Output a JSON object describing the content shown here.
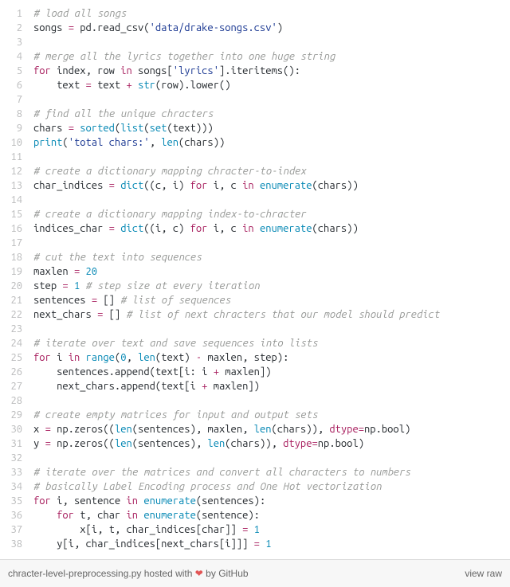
{
  "lines": [
    {
      "n": "1",
      "html": "<span class='c'># load all songs</span>"
    },
    {
      "n": "2",
      "html": "songs <span class='op'>=</span> pd.read_csv(<span class='s'>'data/drake-songs.csv'</span>)"
    },
    {
      "n": "3",
      "html": ""
    },
    {
      "n": "4",
      "html": "<span class='c'># merge all the lyrics together into one huge string</span>"
    },
    {
      "n": "5",
      "html": "<span class='k'>for</span> index, row <span class='k'>in</span> songs[<span class='s'>'lyrics'</span>].iteritems():"
    },
    {
      "n": "6",
      "html": "    text <span class='op'>=</span> text <span class='op'>+</span> <span class='fn'>str</span>(row).lower()"
    },
    {
      "n": "7",
      "html": ""
    },
    {
      "n": "8",
      "html": "<span class='c'># find all the unique chracters</span>"
    },
    {
      "n": "9",
      "html": "chars <span class='op'>=</span> <span class='fn'>sorted</span>(<span class='fn'>list</span>(<span class='fn'>set</span>(text)))"
    },
    {
      "n": "10",
      "html": "<span class='fn'>print</span>(<span class='s'>'total chars:'</span>, <span class='fn'>len</span>(chars))"
    },
    {
      "n": "11",
      "html": ""
    },
    {
      "n": "12",
      "html": "<span class='c'># create a dictionary mapping chracter-to-index</span>"
    },
    {
      "n": "13",
      "html": "char_indices <span class='op'>=</span> <span class='fn'>dict</span>((c, i) <span class='k'>for</span> i, c <span class='k'>in</span> <span class='fn'>enumerate</span>(chars))"
    },
    {
      "n": "14",
      "html": ""
    },
    {
      "n": "15",
      "html": "<span class='c'># create a dictionary mapping index-to-chracter</span>"
    },
    {
      "n": "16",
      "html": "indices_char <span class='op'>=</span> <span class='fn'>dict</span>((i, c) <span class='k'>for</span> i, c <span class='k'>in</span> <span class='fn'>enumerate</span>(chars))"
    },
    {
      "n": "17",
      "html": ""
    },
    {
      "n": "18",
      "html": "<span class='c'># cut the text into sequences</span>"
    },
    {
      "n": "19",
      "html": "maxlen <span class='op'>=</span> <span class='n'>20</span>"
    },
    {
      "n": "20",
      "html": "step <span class='op'>=</span> <span class='n'>1</span> <span class='c'># step size at every iteration</span>"
    },
    {
      "n": "21",
      "html": "sentences <span class='op'>=</span> [] <span class='c'># list of sequences</span>"
    },
    {
      "n": "22",
      "html": "next_chars <span class='op'>=</span> [] <span class='c'># list of next chracters that our model should predict</span>"
    },
    {
      "n": "23",
      "html": ""
    },
    {
      "n": "24",
      "html": "<span class='c'># iterate over text and save sequences into lists</span>"
    },
    {
      "n": "25",
      "html": "<span class='k'>for</span> i <span class='k'>in</span> <span class='fn'>range</span>(<span class='n'>0</span>, <span class='fn'>len</span>(text) <span class='op'>-</span> maxlen, step):"
    },
    {
      "n": "26",
      "html": "    sentences.append(text[i: i <span class='op'>+</span> maxlen])"
    },
    {
      "n": "27",
      "html": "    next_chars.append(text[i <span class='op'>+</span> maxlen])"
    },
    {
      "n": "28",
      "html": ""
    },
    {
      "n": "29",
      "html": "<span class='c'># create empty matrices for input and output sets</span>"
    },
    {
      "n": "30",
      "html": "x <span class='op'>=</span> np.zeros((<span class='fn'>len</span>(sentences), maxlen, <span class='fn'>len</span>(chars)), <span class='kw2'>dtype</span><span class='op'>=</span>np.bool)"
    },
    {
      "n": "31",
      "html": "y <span class='op'>=</span> np.zeros((<span class='fn'>len</span>(sentences), <span class='fn'>len</span>(chars)), <span class='kw2'>dtype</span><span class='op'>=</span>np.bool)"
    },
    {
      "n": "32",
      "html": ""
    },
    {
      "n": "33",
      "html": "<span class='c'># iterate over the matrices and convert all characters to numbers</span>"
    },
    {
      "n": "34",
      "html": "<span class='c'># basically Label Encoding process and One Hot vectorization</span>"
    },
    {
      "n": "35",
      "html": "<span class='k'>for</span> i, sentence <span class='k'>in</span> <span class='fn'>enumerate</span>(sentences):"
    },
    {
      "n": "36",
      "html": "    <span class='k'>for</span> t, char <span class='k'>in</span> <span class='fn'>enumerate</span>(sentence):"
    },
    {
      "n": "37",
      "html": "        x[i, t, char_indices[char]] <span class='op'>=</span> <span class='n'>1</span>"
    },
    {
      "n": "38",
      "html": "    y[i, char_indices[next_chars[i]]] <span class='op'>=</span> <span class='n'>1</span>"
    }
  ],
  "meta": {
    "filename": "chracter-level-preprocessing.py",
    "hosted": " hosted with ",
    "heart": "❤",
    "by": " by ",
    "github": "GitHub",
    "raw": "view raw"
  }
}
